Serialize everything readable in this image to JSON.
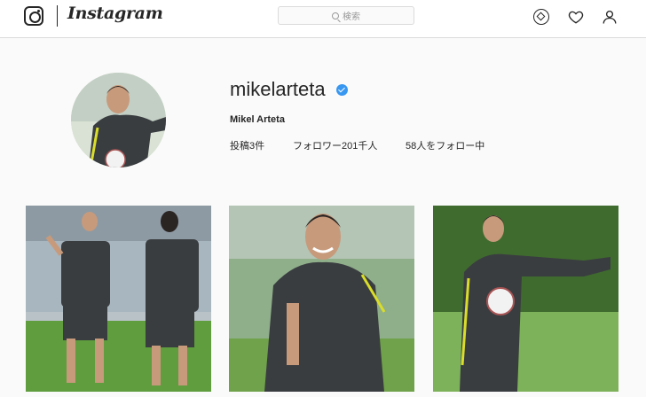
{
  "nav": {
    "brand": "Instagram",
    "search_placeholder": "検索",
    "icons": [
      "instagram-logo-icon",
      "search-icon",
      "compass-icon",
      "heart-icon",
      "person-icon"
    ]
  },
  "profile": {
    "username": "mikelarteta",
    "verified": true,
    "full_name": "Mikel Arteta",
    "stats": {
      "posts": "投稿3件",
      "followers": "フォロワー201千人",
      "following": "58人をフォロー中"
    }
  },
  "posts": [
    {
      "subject": "two coaches on training pitch"
    },
    {
      "subject": "smiling man in training kit"
    },
    {
      "subject": "man holding ball and pointing"
    }
  ],
  "colors": {
    "verified": "#3897f0",
    "kit": "#3a3d40",
    "accent": "#d9dd2a",
    "grass": "#5f9d3e",
    "border": "#dbdbdb"
  }
}
